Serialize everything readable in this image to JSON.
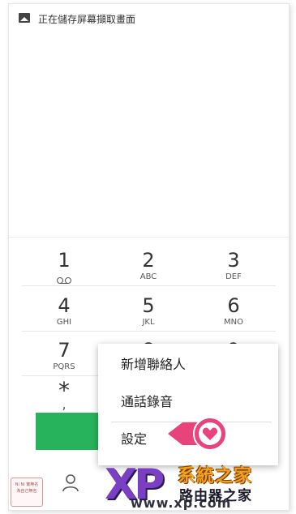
{
  "status_bar": {
    "icon": "image-icon",
    "message": "正在儲存屏幕擷取畫面"
  },
  "keypad": {
    "keys": [
      {
        "digit": "1",
        "letters": ""
      },
      {
        "digit": "2",
        "letters": "ABC"
      },
      {
        "digit": "3",
        "letters": "DEF"
      },
      {
        "digit": "4",
        "letters": "GHI"
      },
      {
        "digit": "5",
        "letters": "JKL"
      },
      {
        "digit": "6",
        "letters": "MNO"
      },
      {
        "digit": "7",
        "letters": "PQRS"
      },
      {
        "digit": "8",
        "letters": ""
      },
      {
        "digit": "9",
        "letters": ""
      },
      {
        "digit": "*",
        "letters": ","
      }
    ]
  },
  "menu": {
    "items": [
      "新增聯絡人",
      "通話錄音",
      "設定"
    ]
  },
  "colors": {
    "call": "#27b35c",
    "badge": "#e8437a"
  },
  "watermark": {
    "xp": "XP",
    "title": "系統之家",
    "subtitle": "路由器之家",
    "url": "www.xp.com"
  },
  "stamp": {
    "line1": "Ni Ni 實無名",
    "line2": "為自己無名"
  }
}
